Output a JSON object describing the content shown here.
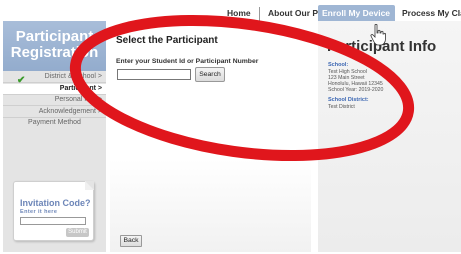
{
  "topnav": {
    "items": [
      {
        "label": "Home"
      },
      {
        "label": "About Our Program"
      },
      {
        "label": "Enroll My Device",
        "active": true
      },
      {
        "label": "Process My Claim"
      }
    ]
  },
  "sidebar": {
    "title_line1": "Participant",
    "title_line2": "Registration",
    "steps": [
      {
        "label": "District & School >",
        "done": true
      },
      {
        "label": "Participant >",
        "current": true
      },
      {
        "label": "Personal Info >"
      },
      {
        "label": "Acknowledgement >"
      },
      {
        "label": "Payment Method"
      }
    ],
    "check_icon": "checkmark-icon",
    "invite": {
      "title": "Invitation Code?",
      "subtitle": "Enter it here",
      "input_value": "",
      "submit_label": "Submit"
    }
  },
  "main": {
    "title": "Select the Participant",
    "id_label": "Enter your Student Id or Participant Number",
    "id_value": "",
    "search_label": "Search",
    "back_label": "Back"
  },
  "info": {
    "title": "Participant Info",
    "school_label": "School:",
    "school_lines": [
      "Test High School",
      "123 Main Street",
      "Honolulu, Hawaii 12345",
      "School Year: 2019-2020"
    ],
    "district_label": "School District:",
    "district_name": "Test District"
  },
  "colors": {
    "accent": "#9fb6d4",
    "annotation": "#e0161c",
    "label_blue": "#3c67b3"
  }
}
